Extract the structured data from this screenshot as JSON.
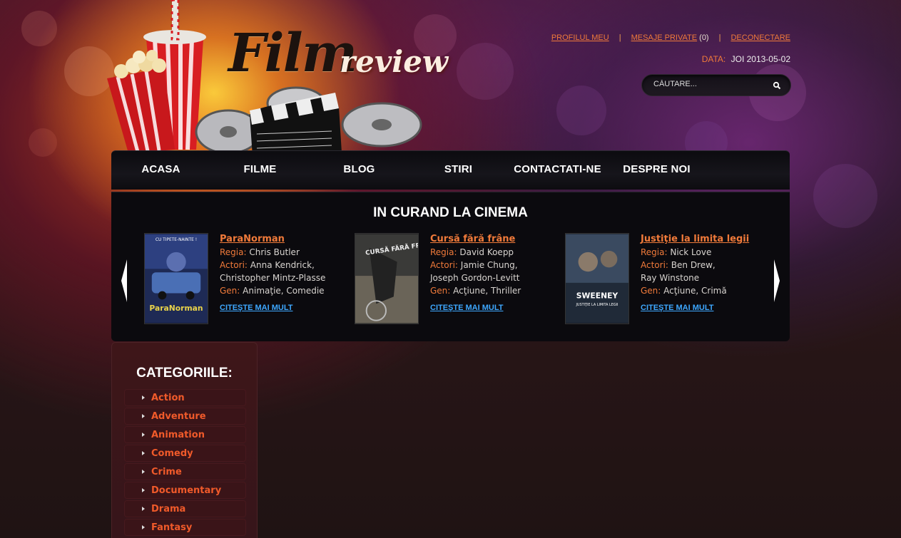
{
  "logo": {
    "word1": "Film",
    "word2": "review"
  },
  "toplinks": {
    "profile": "PROFILUL MEU",
    "messages": "MESAJE PRIVATE",
    "messages_count": "(0)",
    "logout": "DECONECTARE",
    "separator": "|"
  },
  "date": {
    "label": "DATA:",
    "value": "JOI 2013-05-02"
  },
  "search": {
    "placeholder": "CĂUTARE..."
  },
  "nav": [
    "ACASA",
    "FILME",
    "BLOG",
    "STIRI",
    "CONTACTATI-NE",
    "DESPRE NOI"
  ],
  "coming_soon": {
    "title": "IN CURAND LA CINEMA",
    "movies": [
      {
        "title": "ParaNorman",
        "director_label": "Regia:",
        "director": "Chris Butler",
        "actors_label": "Actori:",
        "actors1": "Anna Kendrick,",
        "actors2": "Christopher Mintz-Plasse",
        "genre_label": "Gen:",
        "genre": "Animaţie, Comedie",
        "more": "CITEŞTE MAI MULT",
        "poster_text": "ParaNorman",
        "poster_tag": "CU TIPETE-NAINTE !"
      },
      {
        "title": "Cursă fără frâne",
        "director_label": "Regia:",
        "director": "David Koepp",
        "actors_label": "Actori:",
        "actors1": "Jamie Chung,",
        "actors2": "Joseph Gordon-Levitt",
        "genre_label": "Gen:",
        "genre": "Acţiune, Thriller",
        "more": "CITEŞTE MAI MULT",
        "poster_text": "CURSĂ FĂRĂ FRÂNE"
      },
      {
        "title": "Justiţie la limita legii",
        "director_label": "Regia:",
        "director": "Nick Love",
        "actors_label": "Actori:",
        "actors1": "Ben Drew,",
        "actors2": "Ray Winstone",
        "genre_label": "Gen:",
        "genre": "Acţiune, Crimă",
        "more": "CITEŞTE MAI MULT",
        "poster_text": "SWEENEY",
        "poster_sub": "JUSTIŢIE LA LIMITA LEGII"
      }
    ]
  },
  "categories": {
    "title": "CATEGORIILE:",
    "items": [
      "Action",
      "Adventure",
      "Animation",
      "Comedy",
      "Crime",
      "Documentary",
      "Drama",
      "Fantasy"
    ]
  },
  "colors": {
    "accent": "#f07a3a",
    "link_blue": "#3ea8ff",
    "category_text": "#f05a2a"
  }
}
